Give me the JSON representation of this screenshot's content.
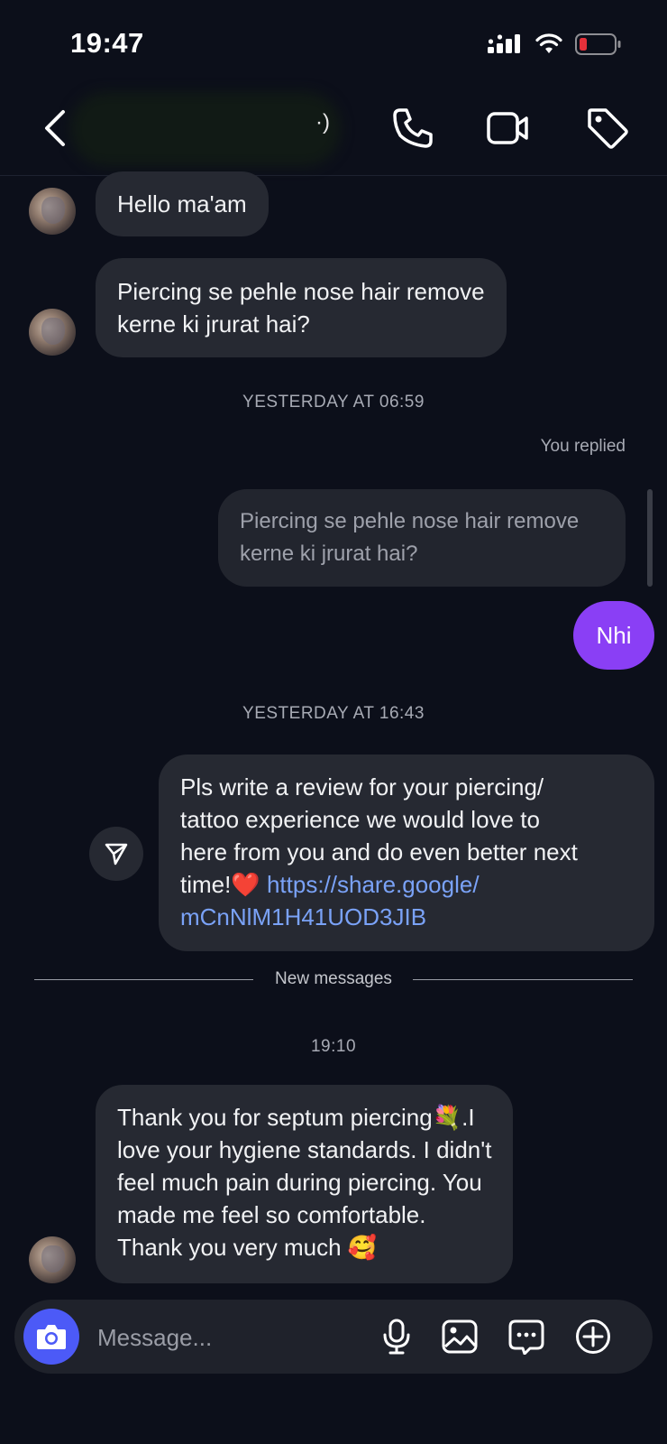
{
  "status_bar": {
    "time": "19:47"
  },
  "header": {
    "redacted_tail": "·)"
  },
  "messages": {
    "incoming_1": "Hello ma'am",
    "incoming_2": [
      "Piercing se pehle nose hair remove",
      "kerne ki jrurat hai?"
    ],
    "timestamp_1": "YESTERDAY AT 06:59",
    "replied_label": "You replied",
    "quoted": [
      "Piercing se pehle nose hair remove",
      "kerne ki jrurat hai?"
    ],
    "outgoing_1": "Nhi",
    "timestamp_2": "YESTERDAY AT 16:43",
    "review": {
      "lines": [
        "Pls write a review for your piercing/",
        "tattoo experience we would love to",
        "here from you and do even better next"
      ],
      "time_text": "time!",
      "heart": "❤️",
      "link_line_1": "https://share.google/",
      "link_line_2": "mCnNlM1H41UOD3JIB"
    },
    "new_messages_label": "New messages",
    "timestamp_3": "19:10",
    "incoming_3": {
      "line_1": "Thank you for septum piercing",
      "flower_emoji": "💐",
      "line_1_end": ".I",
      "lines": [
        "love your hygiene standards. I didn't",
        "feel much pain during piercing. You",
        "made me feel so comfortable."
      ],
      "last_line": "Thank you very much",
      "smile_emoji": "🥰"
    }
  },
  "composer": {
    "placeholder": "Message..."
  },
  "icons": {
    "header": [
      "back-icon",
      "phone-icon",
      "video-icon",
      "tag-icon"
    ],
    "composer": [
      "camera-icon",
      "microphone-icon",
      "gallery-icon",
      "sticker-icon",
      "plus-icon"
    ],
    "share": "send-icon"
  },
  "colors": {
    "background": "#0c0f1a",
    "incoming_bubble": "#262932",
    "outgoing_bubble": "#8a3ff5",
    "link": "#7aa2f7",
    "camera_button": "#4c5af7",
    "battery_low": "#e5303a"
  }
}
